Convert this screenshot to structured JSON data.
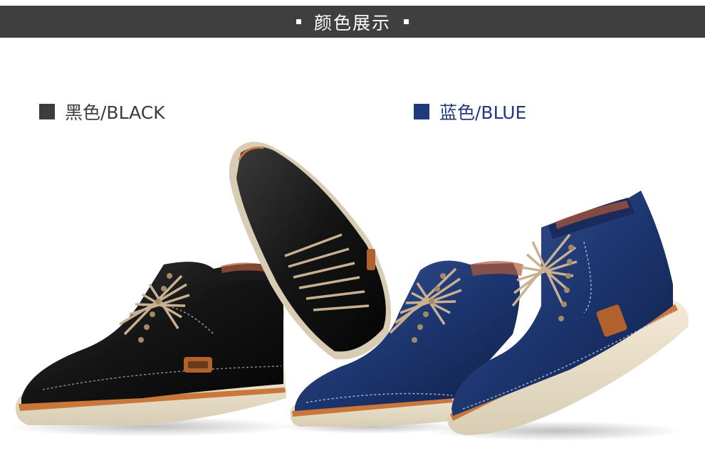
{
  "header": {
    "title": "颜色展示"
  },
  "colors": [
    {
      "label": "黑色/BLACK",
      "swatch": "#3c3c3c"
    },
    {
      "label": "蓝色/BLUE",
      "swatch": "#1f3a7e"
    }
  ],
  "product_photo": {
    "subject": "shoes",
    "colors": [
      "black",
      "navy blue"
    ]
  }
}
